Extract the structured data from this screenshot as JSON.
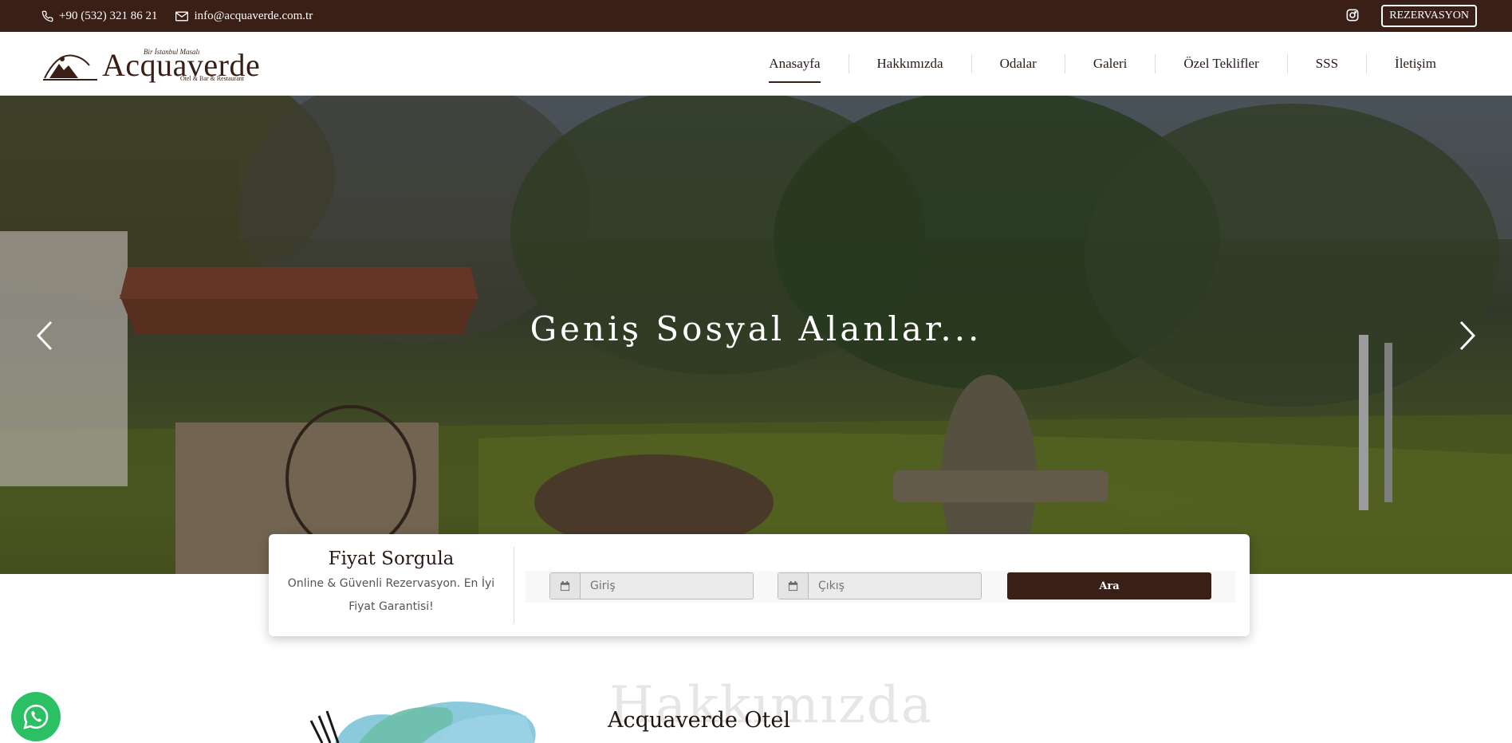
{
  "topbar": {
    "phone": "+90 (532) 321 86 21",
    "email": "info@acquaverde.com.tr",
    "reservation_label": "REZERVASYON",
    "icons": [
      "phone-icon",
      "mail-icon",
      "instagram-icon"
    ]
  },
  "header": {
    "logo": {
      "tagline": "Bir İstanbul Masalı",
      "name": "Acquaverde",
      "subtitle": "Otel & Bar & Restaurant"
    },
    "nav": [
      {
        "label": "Anasayfa",
        "active": true
      },
      {
        "label": "Hakkımızda",
        "active": false
      },
      {
        "label": "Odalar",
        "active": false
      },
      {
        "label": "Galeri",
        "active": false
      },
      {
        "label": "Özel Teklifler",
        "active": false
      },
      {
        "label": "SSS",
        "active": false
      },
      {
        "label": "İletişim",
        "active": false
      }
    ]
  },
  "hero": {
    "title": "Geniş Sosyal Alanlar..."
  },
  "booking": {
    "title": "Fiyat Sorgula",
    "description": "Online & Güvenli Rezervasyon. En İyi Fiyat Garantisi!",
    "checkin_placeholder": "Giriş",
    "checkout_placeholder": "Çıkış",
    "search_label": "Ara"
  },
  "about": {
    "background_word": "Hakkımızda",
    "heading": "Acquaverde Otel"
  },
  "colors": {
    "brand": "#3a1f17",
    "whatsapp": "#2cc064"
  }
}
